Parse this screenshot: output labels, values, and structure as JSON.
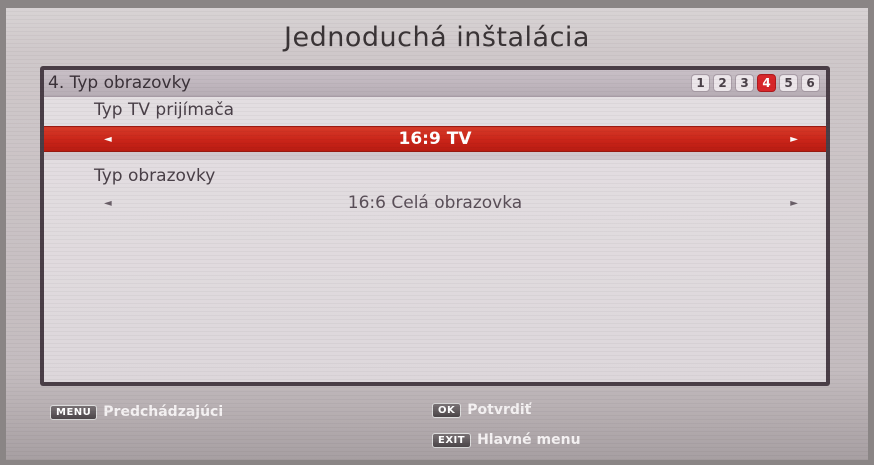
{
  "title": "Jednoduchá inštalácia",
  "panel": {
    "header": "4. Typ obrazovky",
    "steps": [
      "1",
      "2",
      "3",
      "4",
      "5",
      "6"
    ],
    "active_step": "4"
  },
  "fields": [
    {
      "label": "Typ TV prijímača",
      "value": "16:9 TV",
      "selected": true
    },
    {
      "label": "Typ obrazovky",
      "value": "16:6 Celá obrazovka",
      "selected": false
    }
  ],
  "icons": {
    "left": "arrow-left-icon",
    "right": "arrow-right-icon"
  },
  "footer": {
    "menu_key": "MENU",
    "menu_text": "Predchádzajúci",
    "ok_key": "OK",
    "ok_text": "Potvrdiť",
    "exit_key": "EXIT",
    "exit_text": "Hlavné menu"
  },
  "colors": {
    "accent": "#d8262a",
    "panel_border": "#4a3e47"
  }
}
